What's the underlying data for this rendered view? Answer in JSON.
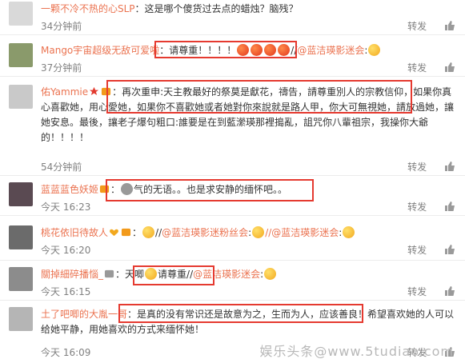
{
  "comments": [
    {
      "name": "一颗不冷不热的心SLP",
      "text": "：这是哪个傻货过去点的蜡烛？脑残？",
      "time": "34分钟前",
      "repost": "转发",
      "avatar_color": "#d9d9d9"
    },
    {
      "name": "Mango宇宙超级无敌可爱啦",
      "text": "：请尊重！！！！",
      "text_after": "//",
      "mention": "@蓝洁瑛影迷会",
      "time": "37分钟前",
      "repost": "转发",
      "avatar_color": "#8a9a6b"
    },
    {
      "name": "佑Yammie",
      "text": "：再次重申:天主教最好的祭莫是獻花，禱告，請尊重別人的宗教信仰，如果你真心喜歡她，用心愛她，如果你不喜歡她或者她對你來說就是路人甲，你大可無視她，請放過她，讓她安息。最後，讓老子爆句粗口:誰要是在到藍瀠瑛那裡搗亂，詛咒你八輩祖宗，我操你大爺的！！！！",
      "time": "54分钟前",
      "repost": "转发",
      "avatar_color": "#c9c9c9"
    },
    {
      "name": "蓝蓝蓝色妖姬",
      "text": "：",
      "text_after": "气的无语。。也是求安静的缅怀吧。。",
      "time": "今天 16:23",
      "repost": "转发",
      "avatar_color": "#5a4a52"
    },
    {
      "name": "桃花依旧待故人",
      "text": "：",
      "text_after": "//",
      "mention": "@蓝洁瑛影迷粉丝会",
      "text_after2": ":",
      "mention2": "//@蓝洁瑛影迷会",
      "time": "今天 16:20",
      "repost": "转发",
      "avatar_color": "#6b6b6b"
    },
    {
      "name": "關掉細碎播惱_",
      "text": "：天唧",
      "text_after": "请尊重",
      "text_after2": "//",
      "mention": "@蓝洁瑛影迷会",
      "time": "今天 16:15",
      "repost": "转发",
      "avatar_color": "#8c8c8c"
    },
    {
      "name": "土了吧唧的大胤一哥",
      "text": "：是真的没有常识还是故意为之，生而为人，应该善良！希望喜欢她的人可以给她平静，用她喜欢的方式来缅怀她！",
      "time": "今天 16:09",
      "repost": "转发",
      "avatar_color": "#b5b5b5"
    }
  ],
  "watermark": "娱乐头条@www.5tudiao.com"
}
